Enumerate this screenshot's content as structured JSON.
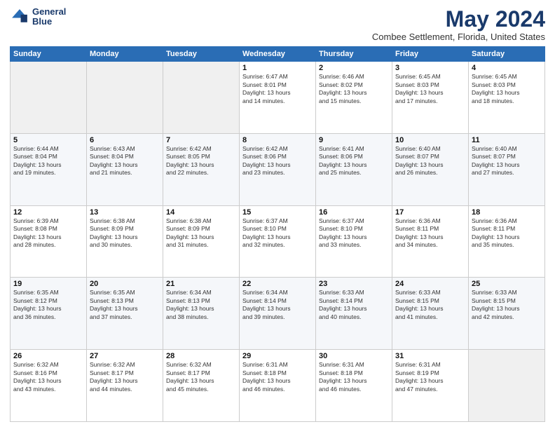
{
  "header": {
    "logo_line1": "General",
    "logo_line2": "Blue",
    "title": "May 2024",
    "subtitle": "Combee Settlement, Florida, United States"
  },
  "days_of_week": [
    "Sunday",
    "Monday",
    "Tuesday",
    "Wednesday",
    "Thursday",
    "Friday",
    "Saturday"
  ],
  "weeks": [
    [
      {
        "day": "",
        "info": ""
      },
      {
        "day": "",
        "info": ""
      },
      {
        "day": "",
        "info": ""
      },
      {
        "day": "1",
        "info": "Sunrise: 6:47 AM\nSunset: 8:01 PM\nDaylight: 13 hours\nand 14 minutes."
      },
      {
        "day": "2",
        "info": "Sunrise: 6:46 AM\nSunset: 8:02 PM\nDaylight: 13 hours\nand 15 minutes."
      },
      {
        "day": "3",
        "info": "Sunrise: 6:45 AM\nSunset: 8:03 PM\nDaylight: 13 hours\nand 17 minutes."
      },
      {
        "day": "4",
        "info": "Sunrise: 6:45 AM\nSunset: 8:03 PM\nDaylight: 13 hours\nand 18 minutes."
      }
    ],
    [
      {
        "day": "5",
        "info": "Sunrise: 6:44 AM\nSunset: 8:04 PM\nDaylight: 13 hours\nand 19 minutes."
      },
      {
        "day": "6",
        "info": "Sunrise: 6:43 AM\nSunset: 8:04 PM\nDaylight: 13 hours\nand 21 minutes."
      },
      {
        "day": "7",
        "info": "Sunrise: 6:42 AM\nSunset: 8:05 PM\nDaylight: 13 hours\nand 22 minutes."
      },
      {
        "day": "8",
        "info": "Sunrise: 6:42 AM\nSunset: 8:06 PM\nDaylight: 13 hours\nand 23 minutes."
      },
      {
        "day": "9",
        "info": "Sunrise: 6:41 AM\nSunset: 8:06 PM\nDaylight: 13 hours\nand 25 minutes."
      },
      {
        "day": "10",
        "info": "Sunrise: 6:40 AM\nSunset: 8:07 PM\nDaylight: 13 hours\nand 26 minutes."
      },
      {
        "day": "11",
        "info": "Sunrise: 6:40 AM\nSunset: 8:07 PM\nDaylight: 13 hours\nand 27 minutes."
      }
    ],
    [
      {
        "day": "12",
        "info": "Sunrise: 6:39 AM\nSunset: 8:08 PM\nDaylight: 13 hours\nand 28 minutes."
      },
      {
        "day": "13",
        "info": "Sunrise: 6:38 AM\nSunset: 8:09 PM\nDaylight: 13 hours\nand 30 minutes."
      },
      {
        "day": "14",
        "info": "Sunrise: 6:38 AM\nSunset: 8:09 PM\nDaylight: 13 hours\nand 31 minutes."
      },
      {
        "day": "15",
        "info": "Sunrise: 6:37 AM\nSunset: 8:10 PM\nDaylight: 13 hours\nand 32 minutes."
      },
      {
        "day": "16",
        "info": "Sunrise: 6:37 AM\nSunset: 8:10 PM\nDaylight: 13 hours\nand 33 minutes."
      },
      {
        "day": "17",
        "info": "Sunrise: 6:36 AM\nSunset: 8:11 PM\nDaylight: 13 hours\nand 34 minutes."
      },
      {
        "day": "18",
        "info": "Sunrise: 6:36 AM\nSunset: 8:11 PM\nDaylight: 13 hours\nand 35 minutes."
      }
    ],
    [
      {
        "day": "19",
        "info": "Sunrise: 6:35 AM\nSunset: 8:12 PM\nDaylight: 13 hours\nand 36 minutes."
      },
      {
        "day": "20",
        "info": "Sunrise: 6:35 AM\nSunset: 8:13 PM\nDaylight: 13 hours\nand 37 minutes."
      },
      {
        "day": "21",
        "info": "Sunrise: 6:34 AM\nSunset: 8:13 PM\nDaylight: 13 hours\nand 38 minutes."
      },
      {
        "day": "22",
        "info": "Sunrise: 6:34 AM\nSunset: 8:14 PM\nDaylight: 13 hours\nand 39 minutes."
      },
      {
        "day": "23",
        "info": "Sunrise: 6:33 AM\nSunset: 8:14 PM\nDaylight: 13 hours\nand 40 minutes."
      },
      {
        "day": "24",
        "info": "Sunrise: 6:33 AM\nSunset: 8:15 PM\nDaylight: 13 hours\nand 41 minutes."
      },
      {
        "day": "25",
        "info": "Sunrise: 6:33 AM\nSunset: 8:15 PM\nDaylight: 13 hours\nand 42 minutes."
      }
    ],
    [
      {
        "day": "26",
        "info": "Sunrise: 6:32 AM\nSunset: 8:16 PM\nDaylight: 13 hours\nand 43 minutes."
      },
      {
        "day": "27",
        "info": "Sunrise: 6:32 AM\nSunset: 8:17 PM\nDaylight: 13 hours\nand 44 minutes."
      },
      {
        "day": "28",
        "info": "Sunrise: 6:32 AM\nSunset: 8:17 PM\nDaylight: 13 hours\nand 45 minutes."
      },
      {
        "day": "29",
        "info": "Sunrise: 6:31 AM\nSunset: 8:18 PM\nDaylight: 13 hours\nand 46 minutes."
      },
      {
        "day": "30",
        "info": "Sunrise: 6:31 AM\nSunset: 8:18 PM\nDaylight: 13 hours\nand 46 minutes."
      },
      {
        "day": "31",
        "info": "Sunrise: 6:31 AM\nSunset: 8:19 PM\nDaylight: 13 hours\nand 47 minutes."
      },
      {
        "day": "",
        "info": ""
      }
    ]
  ]
}
